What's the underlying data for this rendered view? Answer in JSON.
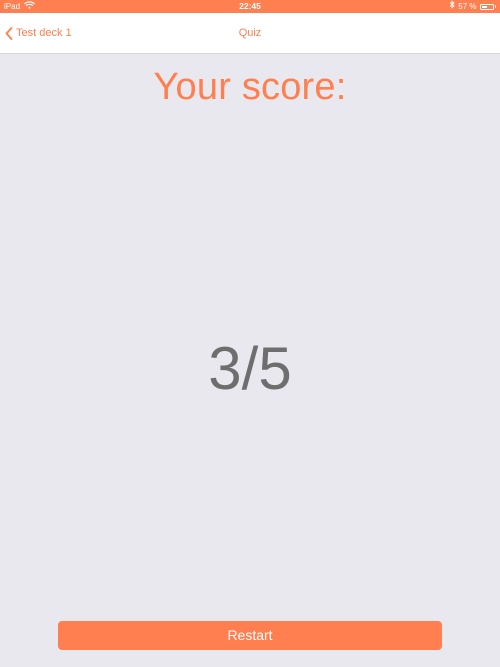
{
  "status_bar": {
    "device": "iPad",
    "time": "22:45",
    "battery_text": "57 %",
    "battery_level": 0.57,
    "icons": [
      "wifi-icon",
      "bluetooth-icon",
      "battery-icon"
    ]
  },
  "nav": {
    "back_label": "Test deck 1",
    "title": "Quiz"
  },
  "content": {
    "heading": "Your score:",
    "score": "3/5"
  },
  "actions": {
    "restart_label": "Restart"
  },
  "colors": {
    "accent": "#ff7f50",
    "background": "#e9e8ef",
    "score_text": "#6e6e6e"
  }
}
